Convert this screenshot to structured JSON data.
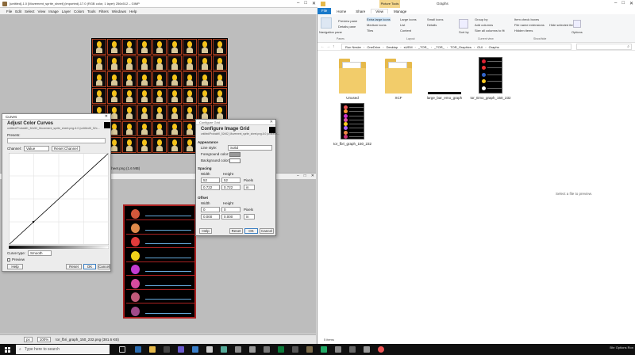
{
  "gimp": {
    "title": "[untitled]-1.0 [Movement_sprite_sheet] (imported)-17.0 (RGB color, 1 layer) 256x512 – GIMP",
    "menu": [
      "File",
      "Edit",
      "Select",
      "View",
      "Image",
      "Layer",
      "Colors",
      "Tools",
      "Filters",
      "Windows",
      "Help"
    ],
    "second_title": "sheet.png (1.6 MB)",
    "second_sub": "ntitle",
    "status_zoom": "100%",
    "status_file": "tor_fbri_graph_150_232.png (381.6 KB)",
    "status_unit": "px"
  },
  "curves": {
    "window_title": "Curves",
    "heading": "Adjust Color Curves",
    "subheading": "untitled/ProbablK_52x52_Movement_sprite_sheet.png-6.0 (untitledK_52x...",
    "presets_label": "Presets:",
    "channel_label": "Channel:",
    "channel_value": "Value",
    "reset_channel": "Reset Channel",
    "curve_type_label": "Curve type:",
    "curve_type_value": "Smooth",
    "preview_label": "Preview",
    "help": "Help",
    "reset": "Reset",
    "ok": "OK",
    "cancel": "Cancel"
  },
  "grid_dialog": {
    "window_title": "Configure Grid",
    "heading": "Configure Image Grid",
    "subheading": "untitled/ProbablK_52x52_Movement_sprite_sheet.png-6.0 (untitledK...",
    "appearance": "Appearance",
    "line_style_label": "Line style:",
    "line_style_value": "Solid",
    "fg_label": "Foreground color:",
    "bg_label": "Background color:",
    "spacing": "Spacing",
    "width": "Width",
    "height": "Height",
    "sp_w": "52",
    "sp_h": "52",
    "sp_unit": "Pixels",
    "sp_w2": "0.722",
    "sp_h2": "0.722",
    "sp_unit2": "in",
    "offset": "Offset",
    "off_width": "Width",
    "off_height": "Height",
    "off_w": "0",
    "off_h": "0",
    "off_unit": "Pixels",
    "off_w2": "0.000",
    "off_h2": "0.000",
    "off_unit2": "in",
    "help": "Help",
    "reset": "Reset",
    "ok": "OK",
    "cancel": "Cancel"
  },
  "explorer": {
    "title": "Graphs",
    "context_tab": "Picture Tools",
    "tabs": [
      "File",
      "Home",
      "Share",
      "View",
      "Manage"
    ],
    "ribbon": {
      "nav_pane": "Navigation pane",
      "preview_pane": "Preview pane",
      "details_pane": "Details pane",
      "extra_large": "Extra large icons",
      "large": "Large icons",
      "medium": "Medium icons",
      "small": "Small icons",
      "list": "List",
      "details": "Details",
      "tiles": "Tiles",
      "content": "Content",
      "sort_by": "Sort by",
      "group_by": "Group by",
      "add_columns": "Add columns",
      "size_all": "Size all columns to fit",
      "item_check": "Item check boxes",
      "file_ext": "File name extensions",
      "hidden_items": "Hidden items",
      "hide_selected": "Hide selected items",
      "options": "Options",
      "g_panes": "Panes",
      "g_layout": "Layout",
      "g_current_view": "Current view",
      "g_show_hide": "Show/hide"
    },
    "path": [
      "Ron Nesler",
      "OneDrive",
      "Desktop",
      "sUEM",
      "_TOR_",
      "_TOR_",
      "TOR_Graphics",
      "GUI",
      "Graphs"
    ],
    "files": [
      {
        "name": "Unused",
        "kind": "folder"
      },
      {
        "name": "XCF",
        "kind": "folder"
      },
      {
        "name": "large_bar_emo_graph",
        "kind": "bar"
      },
      {
        "name": "tor_Emo_graph_150_232",
        "kind": "emo"
      },
      {
        "name": "tor_fbri_graph_150_232",
        "kind": "fbri"
      }
    ],
    "preview_text": "Select a file to preview.",
    "status": "5 items"
  },
  "taskbar": {
    "search_placeholder": "Type here to search",
    "tray_time": "",
    "tray_text": "Bhr Options Ron"
  },
  "colors": {
    "accent": "#1979ca",
    "folder": "#e6b94a",
    "taskbar": "#101010"
  }
}
